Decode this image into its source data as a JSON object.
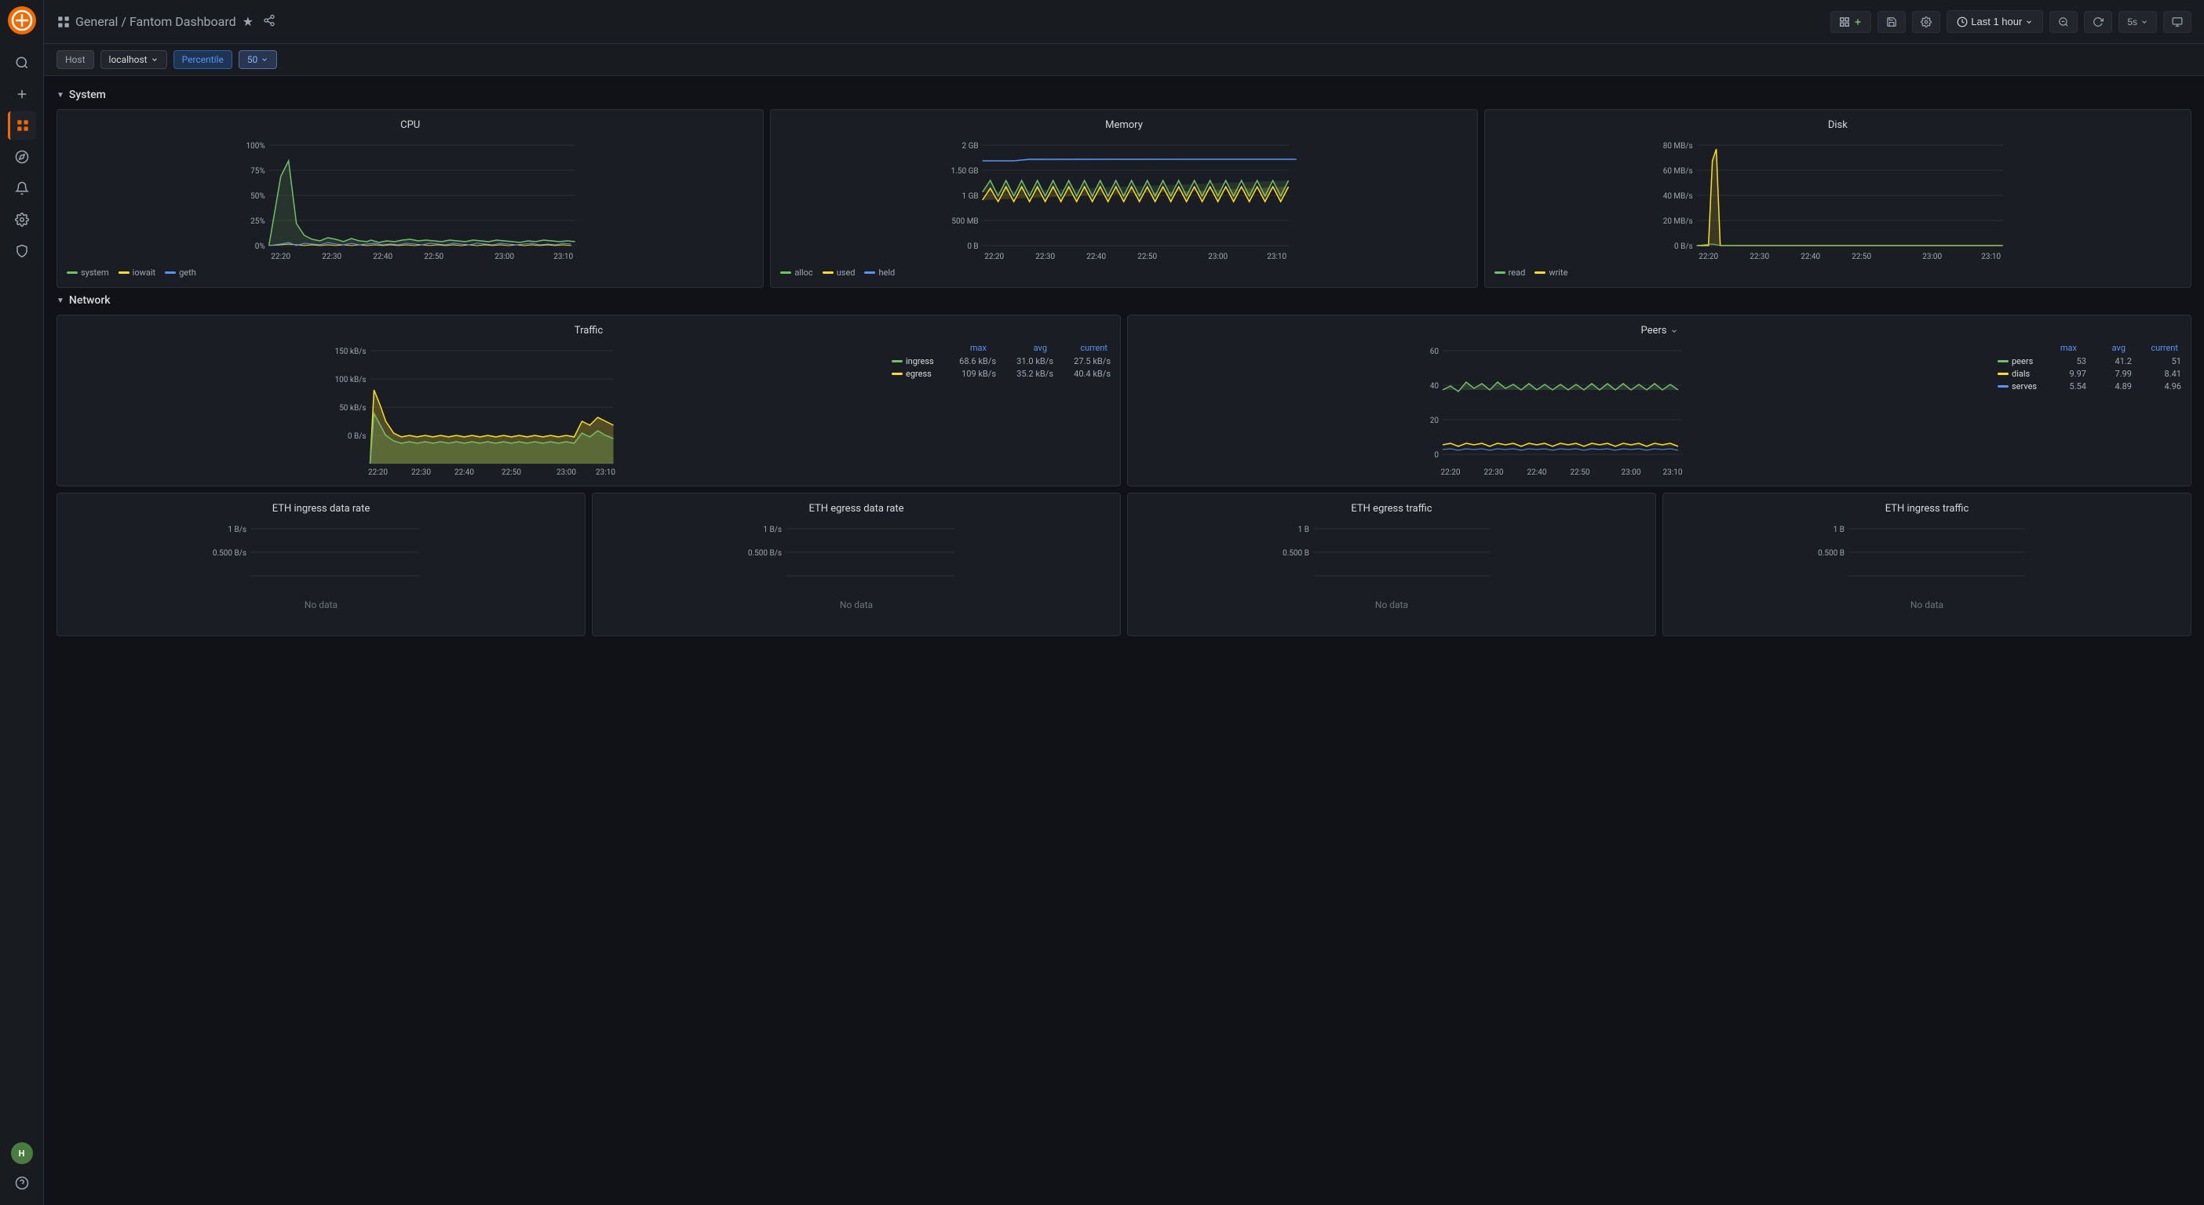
{
  "app": {
    "logo": "🔥",
    "title": "General / Fantom Dashboard"
  },
  "topbar": {
    "breadcrumb_icon": "grid",
    "breadcrumb_general": "General",
    "breadcrumb_separator": "/",
    "breadcrumb_dashboard": "Fantom Dashboard",
    "star_label": "★",
    "share_label": "⋯",
    "add_panel": "+",
    "save_label": "💾",
    "settings_label": "⚙",
    "time_range": "Last 1 hour",
    "zoom_out": "🔍",
    "refresh_icon": "↻",
    "refresh_interval": "5s",
    "tv_mode": "📺"
  },
  "filters": {
    "host_label": "Host",
    "host_value": "localhost",
    "percentile_label": "Percentile",
    "percentile_value": "50"
  },
  "sections": {
    "system": "System",
    "network": "Network"
  },
  "panels": {
    "cpu": {
      "title": "CPU",
      "y_labels": [
        "100%",
        "75%",
        "50%",
        "25%",
        "0%"
      ],
      "x_labels": [
        "22:20",
        "22:30",
        "22:40",
        "22:50",
        "23:00",
        "23:10"
      ],
      "legend": [
        {
          "name": "system",
          "color": "#73bf69"
        },
        {
          "name": "iowait",
          "color": "#fade2a"
        },
        {
          "name": "geth",
          "color": "#5794f2"
        }
      ]
    },
    "memory": {
      "title": "Memory",
      "y_labels": [
        "2 GB",
        "1.50 GB",
        "1 GB",
        "500 MB",
        "0 B"
      ],
      "x_labels": [
        "22:20",
        "22:30",
        "22:40",
        "22:50",
        "23:00",
        "23:10"
      ],
      "legend": [
        {
          "name": "alloc",
          "color": "#73bf69"
        },
        {
          "name": "used",
          "color": "#fade2a"
        },
        {
          "name": "held",
          "color": "#5794f2"
        }
      ]
    },
    "disk": {
      "title": "Disk",
      "y_labels": [
        "80 MB/s",
        "60 MB/s",
        "40 MB/s",
        "20 MB/s",
        "0 B/s"
      ],
      "x_labels": [
        "22:20",
        "22:30",
        "22:40",
        "22:50",
        "23:00",
        "23:10"
      ],
      "legend": [
        {
          "name": "read",
          "color": "#73bf69"
        },
        {
          "name": "write",
          "color": "#fade2a"
        }
      ]
    },
    "traffic": {
      "title": "Traffic",
      "y_labels": [
        "150 kB/s",
        "100 kB/s",
        "50 kB/s",
        "0 B/s"
      ],
      "x_labels": [
        "22:20",
        "22:30",
        "22:40",
        "22:50",
        "23:00",
        "23:10"
      ],
      "stats_headers": [
        "max",
        "avg",
        "current"
      ],
      "stats": [
        {
          "name": "ingress",
          "color": "#73bf69",
          "max": "68.6 kB/s",
          "avg": "31.0 kB/s",
          "current": "27.5 kB/s"
        },
        {
          "name": "egress",
          "color": "#fade2a",
          "max": "109 kB/s",
          "avg": "35.2 kB/s",
          "current": "40.4 kB/s"
        }
      ]
    },
    "peers": {
      "title": "Peers",
      "y_labels": [
        "60",
        "40",
        "20",
        "0"
      ],
      "x_labels": [
        "22:20",
        "22:30",
        "22:40",
        "22:50",
        "23:00",
        "23:10"
      ],
      "stats_headers": [
        "max",
        "avg",
        "current"
      ],
      "stats": [
        {
          "name": "peers",
          "color": "#73bf69",
          "max": "53",
          "avg": "41.2",
          "current": "51"
        },
        {
          "name": "dials",
          "color": "#fade2a",
          "max": "9.97",
          "avg": "7.99",
          "current": "8.41"
        },
        {
          "name": "serves",
          "color": "#5794f2",
          "max": "5.54",
          "avg": "4.89",
          "current": "4.96"
        }
      ]
    },
    "eth_ingress_rate": {
      "title": "ETH ingress data rate",
      "y_labels": [
        "1 B/s",
        "0.500 B/s"
      ],
      "no_data": "No data"
    },
    "eth_egress_rate": {
      "title": "ETH egress data rate",
      "y_labels": [
        "1 B/s",
        "0.500 B/s"
      ],
      "no_data": "No data"
    },
    "eth_egress_traffic": {
      "title": "ETH egress traffic",
      "y_labels": [
        "1 B",
        "0.500 B"
      ],
      "no_data": "No data"
    },
    "eth_ingress_traffic": {
      "title": "ETH ingress traffic",
      "y_labels": [
        "1 B",
        "0.500 B"
      ],
      "no_data": "No data"
    }
  }
}
